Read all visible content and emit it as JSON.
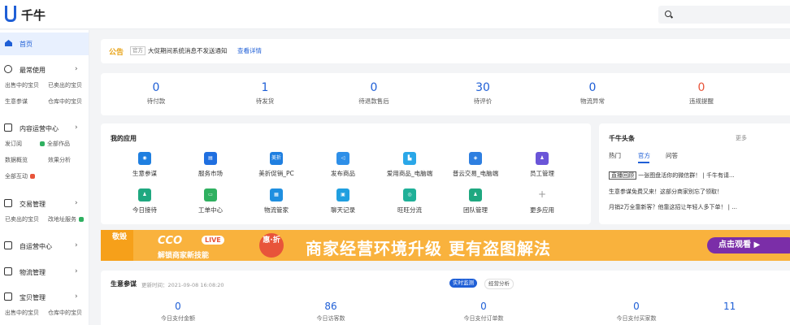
{
  "app": {
    "logo_text": "千牛"
  },
  "sidebar": {
    "home": "首页",
    "groups": [
      {
        "title": "最常使用",
        "subs": [
          "出售中的宝贝",
          "已卖出的宝贝",
          "生意参谋",
          "仓库中的宝贝"
        ]
      },
      {
        "title": "内容运营中心",
        "subs": [
          "发订阅",
          "全部作品",
          "数据概览",
          "效果分析",
          "全部互动"
        ]
      },
      {
        "title": "交易管理",
        "subs": [
          "已卖出的宝贝",
          "改地址服务"
        ]
      },
      {
        "title": "自运营中心",
        "subs": []
      },
      {
        "title": "物流管理",
        "subs": []
      },
      {
        "title": "宝贝管理",
        "subs": [
          "出售中的宝贝",
          "仓库中的宝贝"
        ]
      }
    ],
    "chevron": "›"
  },
  "notice": {
    "title": "公告",
    "tag": "官方",
    "text": "大促期间系统消息不发送通知",
    "link": "查看详情"
  },
  "stats": [
    {
      "value": "0",
      "label": "待付款"
    },
    {
      "value": "1",
      "label": "待发货"
    },
    {
      "value": "0",
      "label": "待退款售后"
    },
    {
      "value": "30",
      "label": "待评价"
    },
    {
      "value": "0",
      "label": "物流异常"
    },
    {
      "value": "0",
      "label": "违规提醒"
    }
  ],
  "apps": {
    "title": "我的应用",
    "items": [
      {
        "label": "生意参谋",
        "color": "#1f7fe0",
        "glyph": "◉"
      },
      {
        "label": "服务市场",
        "color": "#1f6fe0",
        "glyph": "▤"
      },
      {
        "label": "美折促销_PC",
        "color": "#1f7fe0",
        "glyph": "美折"
      },
      {
        "label": "发布商品",
        "color": "#2e8fe8",
        "glyph": "◁"
      },
      {
        "label": "爱用商品_电脑端",
        "color": "#2aa7e8",
        "glyph": "▙"
      },
      {
        "label": "普云交易_电脑端",
        "color": "#2e7fe0",
        "glyph": "◈"
      },
      {
        "label": "员工管理",
        "color": "#6a55d8",
        "glyph": "♟"
      },
      {
        "label": "今日接待",
        "color": "#1fa880",
        "glyph": "♟"
      },
      {
        "label": "工单中心",
        "color": "#2fb060",
        "glyph": "▭"
      },
      {
        "label": "物流管家",
        "color": "#1f8fe0",
        "glyph": "▦"
      },
      {
        "label": "聊天记录",
        "color": "#1f9fe0",
        "glyph": "▣"
      },
      {
        "label": "旺旺分流",
        "color": "#1fb098",
        "glyph": "◎"
      },
      {
        "label": "团队管理",
        "color": "#1fa880",
        "glyph": "♟"
      },
      {
        "label": "更多应用",
        "color": "",
        "glyph": "+"
      }
    ]
  },
  "news": {
    "title": "千牛头条",
    "more": "更多",
    "tabs": [
      "热门",
      "官方",
      "问答"
    ],
    "lines": [
      {
        "tag": "直播回顾",
        "text": "一张图盘活你的微信群！ | 千牛有请..."
      },
      {
        "tag": "",
        "text": "生意参谋免费又来！这部分商家别忘了领取！"
      },
      {
        "tag": "",
        "text": "月销2万全靠新客？他靠这招让年轻人多下单！ | ..."
      }
    ]
  },
  "banner": {
    "left_text": "敬毁",
    "live_logo": "CCO",
    "live_pill": "LIVE",
    "sub": "解锁商家新技能",
    "badge": "惠·折",
    "main": "商家经营环境升级  更有盗图解法",
    "cta": "点击观看 ▶"
  },
  "biz": {
    "title": "生意参谋",
    "time": "更新时间：2021-09-08 16:08:20",
    "tab_active": "实时监测",
    "tab_plain": "经营分析",
    "stats": [
      {
        "value": "0",
        "label": "今日支付金额"
      },
      {
        "value": "86",
        "label": "今日访客数"
      },
      {
        "value": "0",
        "label": "今日支付订单数"
      },
      {
        "value": "0",
        "label": "今日支付买家数"
      },
      {
        "value": "11",
        "label": ""
      }
    ]
  }
}
